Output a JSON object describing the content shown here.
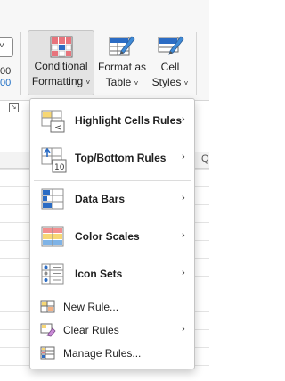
{
  "ribbon": {
    "left_partial_lines": [
      "00",
      "00"
    ],
    "conditional_formatting": {
      "line1": "Conditional",
      "line2": "Formatting",
      "caret": "˅"
    },
    "format_as_table": {
      "line1": "Format as",
      "line2": "Table",
      "caret": "˅"
    },
    "cell_styles": {
      "line1": "Cell",
      "line2": "Styles",
      "caret": "˅"
    }
  },
  "sheet": {
    "column_letter": "Q"
  },
  "menu": {
    "items": [
      {
        "label": "Highlight Cells Rules",
        "icon": "highlight-cells-rules-icon",
        "has_submenu": true
      },
      {
        "label": "Top/Bottom Rules",
        "icon": "top-bottom-rules-icon",
        "has_submenu": true
      },
      {
        "label": "Data Bars",
        "icon": "data-bars-icon",
        "has_submenu": true
      },
      {
        "label": "Color Scales",
        "icon": "color-scales-icon",
        "has_submenu": true
      },
      {
        "label": "Icon Sets",
        "icon": "icon-sets-icon",
        "has_submenu": true
      },
      {
        "label": "New Rule...",
        "icon": "new-rule-icon",
        "has_submenu": false
      },
      {
        "label": "Clear Rules",
        "icon": "clear-rules-icon",
        "has_submenu": true
      },
      {
        "label": "Manage Rules...",
        "icon": "manage-rules-icon",
        "has_submenu": false
      }
    ],
    "submenu_arrow": "›"
  },
  "colors": {
    "accent_blue": "#2b6cc4",
    "table_red": "#e8747c",
    "icon_gray": "#8c8c8c",
    "highlight_yellow": "#f7d774"
  }
}
